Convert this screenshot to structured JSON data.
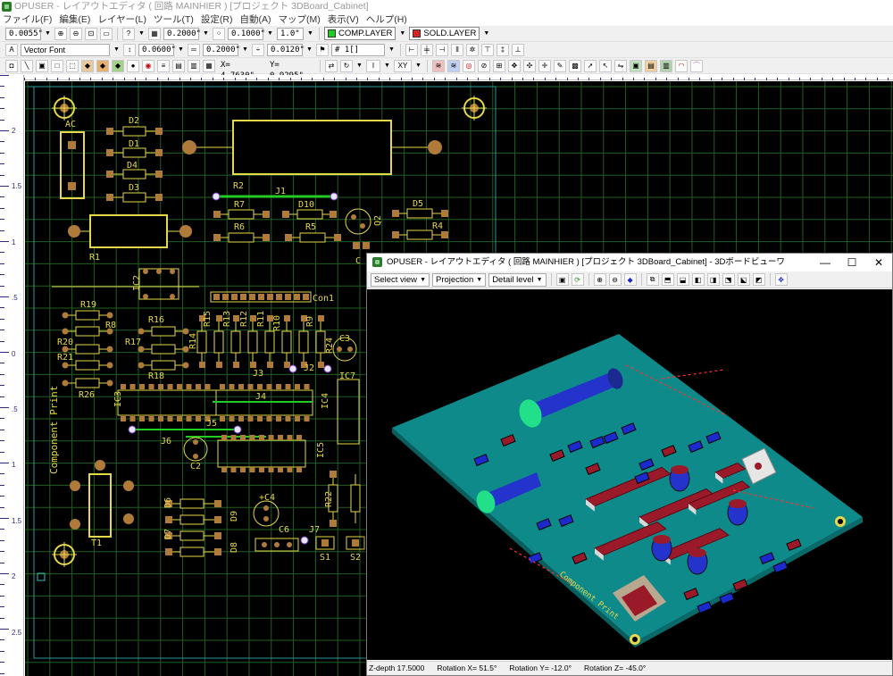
{
  "app": {
    "title": "OPUSER - レイアウトエディタ ( 回路 MAINHIER ) [プロジェクト 3DBoard_Cabinet]"
  },
  "menu": [
    "ファイル(F)",
    "編集(E)",
    "レイヤー(L)",
    "ツール(T)",
    "設定(R)",
    "自動(A)",
    "マップ(M)",
    "表示(V)",
    "ヘルプ(H)"
  ],
  "toolbar1": {
    "grid_snap": "0.0055\"",
    "grid1": "0.2000\"",
    "grid2": "0.1000\"",
    "grid3": "1.0\"",
    "comp_layer": "COMP.LAYER",
    "comp_color": "#22cc22",
    "sold_layer": "SOLD.LAYER",
    "sold_color": "#dd2222"
  },
  "toolbar2": {
    "font": "Vector Font",
    "size1": "0.0600\"",
    "size2": "0.2000\"",
    "size3": "0.0120\"",
    "net": "# 1[]"
  },
  "toolbar3": {
    "x_coord": "X= 4.7630\"",
    "y_coord": "Y= 0.9295\"",
    "i_label": "I",
    "xy_label": "XY"
  },
  "ruler": {
    "labels": [
      "2",
      "1.5",
      "1",
      ".5",
      "0",
      ".5",
      "1",
      "1.5",
      "2",
      "2.5"
    ]
  },
  "pcb": {
    "labels": {
      "ac": "AC",
      "d2": "D2",
      "d1": "D1",
      "d4": "D4",
      "d3": "D3",
      "r2": "R2",
      "j1": "J1",
      "r7": "R7",
      "d10": "D10",
      "q2": "Q2",
      "d5": "D5",
      "r6": "R6",
      "r5": "R5",
      "r4": "R4",
      "r1": "R1",
      "c": "C",
      "ic2": "IC2",
      "con1": "Con1",
      "r19": "R19",
      "r8": "R8",
      "r16": "R16",
      "r20": "R20",
      "r17": "R17",
      "r21": "R21",
      "r18": "R18",
      "r26": "R26",
      "r15": "R15",
      "r13": "R13",
      "r12": "R12",
      "r11": "R11",
      "r10": "R10",
      "r9": "R9",
      "r14": "R14",
      "r24": "R24",
      "c3": "C3",
      "j3": "J3",
      "j2": "J2",
      "ic7": "IC7",
      "ic3": "IC3",
      "j4": "J4",
      "ic4": "IC4",
      "j5": "J5",
      "j6": "J6",
      "ic5": "IC5",
      "c2": "C2",
      "comp_print": "Component Print",
      "t1": "T1",
      "d6": "D6",
      "d9": "D9",
      "c4": "+C4",
      "d7": "D7",
      "d8": "D8",
      "c6": "C6",
      "j7": "J7",
      "r22": "R22",
      "s1": "S1",
      "s2": "S2"
    }
  },
  "viewer3d": {
    "title": "OPUSER - レイアウトエディタ ( 回路 MAINHIER ) [プロジェクト 3DBoard_Cabinet] - 3Dボードビューワ",
    "select_view": "Select view",
    "projection": "Projection",
    "detail_level": "Detail level",
    "board_text": "Component Print",
    "status": {
      "zdepth": "Z-depth 17.5000",
      "rot_x": "Rotation X= 51.5°",
      "rot_y": "Rotation Y= -12.0°",
      "rot_z": "Rotation Z= -45.0°"
    }
  },
  "colors": {
    "grid": "#1f5f1f",
    "pcb_outline": "#e6d84a",
    "pad": "#b07a3a",
    "board_3d": "#0f8a8a",
    "chip_3d": "#9a1a2a",
    "part_3d": "#1a2acc"
  }
}
